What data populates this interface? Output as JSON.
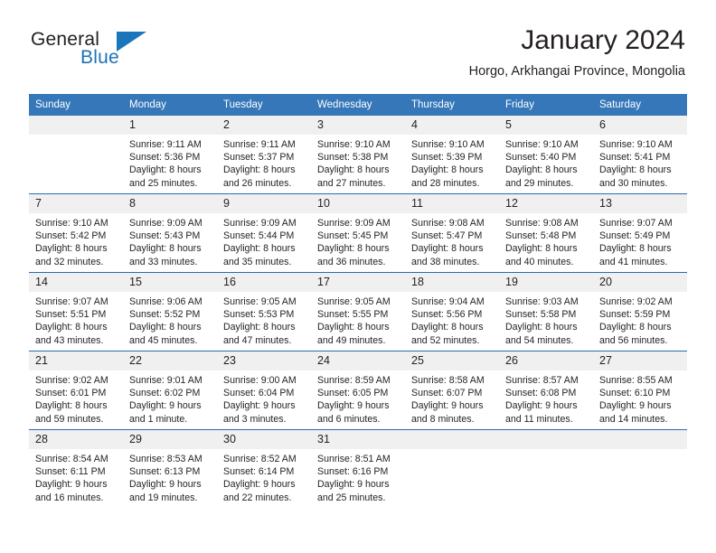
{
  "brand": {
    "name_top": "General",
    "name_bottom": "Blue",
    "accent_color": "#1b75bb",
    "text_color": "#231f20"
  },
  "header": {
    "title": "January 2024",
    "subtitle": "Horgo, Arkhangai Province, Mongolia"
  },
  "theme": {
    "header_row_bg": "#3577b9",
    "row_divider": "#2a6cb0",
    "daynum_bg": "#f0f0f0",
    "page_bg": "#ffffff"
  },
  "weekdays": [
    "Sunday",
    "Monday",
    "Tuesday",
    "Wednesday",
    "Thursday",
    "Friday",
    "Saturday"
  ],
  "weeks": [
    [
      {
        "day": "",
        "sunrise": "",
        "sunset": "",
        "daylight_line1": "",
        "daylight_line2": ""
      },
      {
        "day": "1",
        "sunrise": "Sunrise: 9:11 AM",
        "sunset": "Sunset: 5:36 PM",
        "daylight_line1": "Daylight: 8 hours",
        "daylight_line2": "and 25 minutes."
      },
      {
        "day": "2",
        "sunrise": "Sunrise: 9:11 AM",
        "sunset": "Sunset: 5:37 PM",
        "daylight_line1": "Daylight: 8 hours",
        "daylight_line2": "and 26 minutes."
      },
      {
        "day": "3",
        "sunrise": "Sunrise: 9:10 AM",
        "sunset": "Sunset: 5:38 PM",
        "daylight_line1": "Daylight: 8 hours",
        "daylight_line2": "and 27 minutes."
      },
      {
        "day": "4",
        "sunrise": "Sunrise: 9:10 AM",
        "sunset": "Sunset: 5:39 PM",
        "daylight_line1": "Daylight: 8 hours",
        "daylight_line2": "and 28 minutes."
      },
      {
        "day": "5",
        "sunrise": "Sunrise: 9:10 AM",
        "sunset": "Sunset: 5:40 PM",
        "daylight_line1": "Daylight: 8 hours",
        "daylight_line2": "and 29 minutes."
      },
      {
        "day": "6",
        "sunrise": "Sunrise: 9:10 AM",
        "sunset": "Sunset: 5:41 PM",
        "daylight_line1": "Daylight: 8 hours",
        "daylight_line2": "and 30 minutes."
      }
    ],
    [
      {
        "day": "7",
        "sunrise": "Sunrise: 9:10 AM",
        "sunset": "Sunset: 5:42 PM",
        "daylight_line1": "Daylight: 8 hours",
        "daylight_line2": "and 32 minutes."
      },
      {
        "day": "8",
        "sunrise": "Sunrise: 9:09 AM",
        "sunset": "Sunset: 5:43 PM",
        "daylight_line1": "Daylight: 8 hours",
        "daylight_line2": "and 33 minutes."
      },
      {
        "day": "9",
        "sunrise": "Sunrise: 9:09 AM",
        "sunset": "Sunset: 5:44 PM",
        "daylight_line1": "Daylight: 8 hours",
        "daylight_line2": "and 35 minutes."
      },
      {
        "day": "10",
        "sunrise": "Sunrise: 9:09 AM",
        "sunset": "Sunset: 5:45 PM",
        "daylight_line1": "Daylight: 8 hours",
        "daylight_line2": "and 36 minutes."
      },
      {
        "day": "11",
        "sunrise": "Sunrise: 9:08 AM",
        "sunset": "Sunset: 5:47 PM",
        "daylight_line1": "Daylight: 8 hours",
        "daylight_line2": "and 38 minutes."
      },
      {
        "day": "12",
        "sunrise": "Sunrise: 9:08 AM",
        "sunset": "Sunset: 5:48 PM",
        "daylight_line1": "Daylight: 8 hours",
        "daylight_line2": "and 40 minutes."
      },
      {
        "day": "13",
        "sunrise": "Sunrise: 9:07 AM",
        "sunset": "Sunset: 5:49 PM",
        "daylight_line1": "Daylight: 8 hours",
        "daylight_line2": "and 41 minutes."
      }
    ],
    [
      {
        "day": "14",
        "sunrise": "Sunrise: 9:07 AM",
        "sunset": "Sunset: 5:51 PM",
        "daylight_line1": "Daylight: 8 hours",
        "daylight_line2": "and 43 minutes."
      },
      {
        "day": "15",
        "sunrise": "Sunrise: 9:06 AM",
        "sunset": "Sunset: 5:52 PM",
        "daylight_line1": "Daylight: 8 hours",
        "daylight_line2": "and 45 minutes."
      },
      {
        "day": "16",
        "sunrise": "Sunrise: 9:05 AM",
        "sunset": "Sunset: 5:53 PM",
        "daylight_line1": "Daylight: 8 hours",
        "daylight_line2": "and 47 minutes."
      },
      {
        "day": "17",
        "sunrise": "Sunrise: 9:05 AM",
        "sunset": "Sunset: 5:55 PM",
        "daylight_line1": "Daylight: 8 hours",
        "daylight_line2": "and 49 minutes."
      },
      {
        "day": "18",
        "sunrise": "Sunrise: 9:04 AM",
        "sunset": "Sunset: 5:56 PM",
        "daylight_line1": "Daylight: 8 hours",
        "daylight_line2": "and 52 minutes."
      },
      {
        "day": "19",
        "sunrise": "Sunrise: 9:03 AM",
        "sunset": "Sunset: 5:58 PM",
        "daylight_line1": "Daylight: 8 hours",
        "daylight_line2": "and 54 minutes."
      },
      {
        "day": "20",
        "sunrise": "Sunrise: 9:02 AM",
        "sunset": "Sunset: 5:59 PM",
        "daylight_line1": "Daylight: 8 hours",
        "daylight_line2": "and 56 minutes."
      }
    ],
    [
      {
        "day": "21",
        "sunrise": "Sunrise: 9:02 AM",
        "sunset": "Sunset: 6:01 PM",
        "daylight_line1": "Daylight: 8 hours",
        "daylight_line2": "and 59 minutes."
      },
      {
        "day": "22",
        "sunrise": "Sunrise: 9:01 AM",
        "sunset": "Sunset: 6:02 PM",
        "daylight_line1": "Daylight: 9 hours",
        "daylight_line2": "and 1 minute."
      },
      {
        "day": "23",
        "sunrise": "Sunrise: 9:00 AM",
        "sunset": "Sunset: 6:04 PM",
        "daylight_line1": "Daylight: 9 hours",
        "daylight_line2": "and 3 minutes."
      },
      {
        "day": "24",
        "sunrise": "Sunrise: 8:59 AM",
        "sunset": "Sunset: 6:05 PM",
        "daylight_line1": "Daylight: 9 hours",
        "daylight_line2": "and 6 minutes."
      },
      {
        "day": "25",
        "sunrise": "Sunrise: 8:58 AM",
        "sunset": "Sunset: 6:07 PM",
        "daylight_line1": "Daylight: 9 hours",
        "daylight_line2": "and 8 minutes."
      },
      {
        "day": "26",
        "sunrise": "Sunrise: 8:57 AM",
        "sunset": "Sunset: 6:08 PM",
        "daylight_line1": "Daylight: 9 hours",
        "daylight_line2": "and 11 minutes."
      },
      {
        "day": "27",
        "sunrise": "Sunrise: 8:55 AM",
        "sunset": "Sunset: 6:10 PM",
        "daylight_line1": "Daylight: 9 hours",
        "daylight_line2": "and 14 minutes."
      }
    ],
    [
      {
        "day": "28",
        "sunrise": "Sunrise: 8:54 AM",
        "sunset": "Sunset: 6:11 PM",
        "daylight_line1": "Daylight: 9 hours",
        "daylight_line2": "and 16 minutes."
      },
      {
        "day": "29",
        "sunrise": "Sunrise: 8:53 AM",
        "sunset": "Sunset: 6:13 PM",
        "daylight_line1": "Daylight: 9 hours",
        "daylight_line2": "and 19 minutes."
      },
      {
        "day": "30",
        "sunrise": "Sunrise: 8:52 AM",
        "sunset": "Sunset: 6:14 PM",
        "daylight_line1": "Daylight: 9 hours",
        "daylight_line2": "and 22 minutes."
      },
      {
        "day": "31",
        "sunrise": "Sunrise: 8:51 AM",
        "sunset": "Sunset: 6:16 PM",
        "daylight_line1": "Daylight: 9 hours",
        "daylight_line2": "and 25 minutes."
      },
      {
        "day": "",
        "sunrise": "",
        "sunset": "",
        "daylight_line1": "",
        "daylight_line2": ""
      },
      {
        "day": "",
        "sunrise": "",
        "sunset": "",
        "daylight_line1": "",
        "daylight_line2": ""
      },
      {
        "day": "",
        "sunrise": "",
        "sunset": "",
        "daylight_line1": "",
        "daylight_line2": ""
      }
    ]
  ]
}
